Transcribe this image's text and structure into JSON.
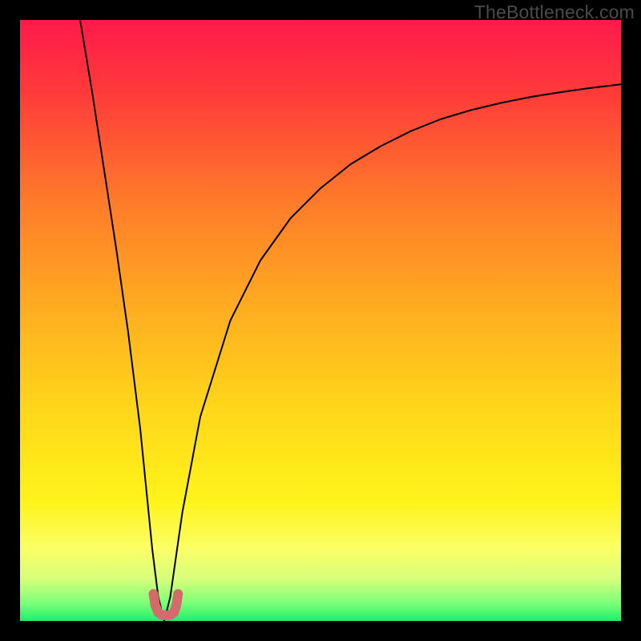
{
  "watermark": "TheBottleneck.com",
  "chart_data": {
    "type": "line",
    "title": "",
    "xlabel": "",
    "ylabel": "",
    "xlim": [
      0,
      100
    ],
    "ylim": [
      0,
      100
    ],
    "grid": false,
    "legend": false,
    "background_gradient_stops": [
      {
        "pct": 0,
        "color": "#ff1a4b"
      },
      {
        "pct": 12,
        "color": "#ff3a3a"
      },
      {
        "pct": 30,
        "color": "#ff7a2a"
      },
      {
        "pct": 50,
        "color": "#ffb21f"
      },
      {
        "pct": 65,
        "color": "#ffd71a"
      },
      {
        "pct": 80,
        "color": "#fff31a"
      },
      {
        "pct": 88,
        "color": "#faff66"
      },
      {
        "pct": 93,
        "color": "#d7ff7a"
      },
      {
        "pct": 97,
        "color": "#7dff7a"
      },
      {
        "pct": 100,
        "color": "#1fef6a"
      }
    ],
    "series": [
      {
        "name": "bottleneck-curve",
        "color": "#000000",
        "width": 2,
        "x": [
          10,
          12,
          14,
          16,
          18,
          20,
          21,
          22,
          23,
          24,
          25,
          27,
          30,
          35,
          40,
          45,
          50,
          55,
          60,
          65,
          70,
          75,
          80,
          85,
          90,
          95,
          100
        ],
        "y": [
          100,
          88,
          75,
          62,
          48,
          32,
          22,
          12,
          4,
          0,
          4,
          18,
          34,
          50,
          60,
          67,
          72,
          76,
          79,
          81.5,
          83.5,
          85,
          86.2,
          87.2,
          88,
          88.7,
          89.3
        ]
      },
      {
        "name": "optimal-marker",
        "color": "#d46a6a",
        "width": 12,
        "linecap": "round",
        "x": [
          22.2,
          22.5,
          23.0,
          23.6,
          24.3,
          25.0,
          25.6,
          26.0,
          26.3
        ],
        "y": [
          4.5,
          2.6,
          1.4,
          1.0,
          0.9,
          1.0,
          1.4,
          2.6,
          4.5
        ]
      }
    ]
  }
}
